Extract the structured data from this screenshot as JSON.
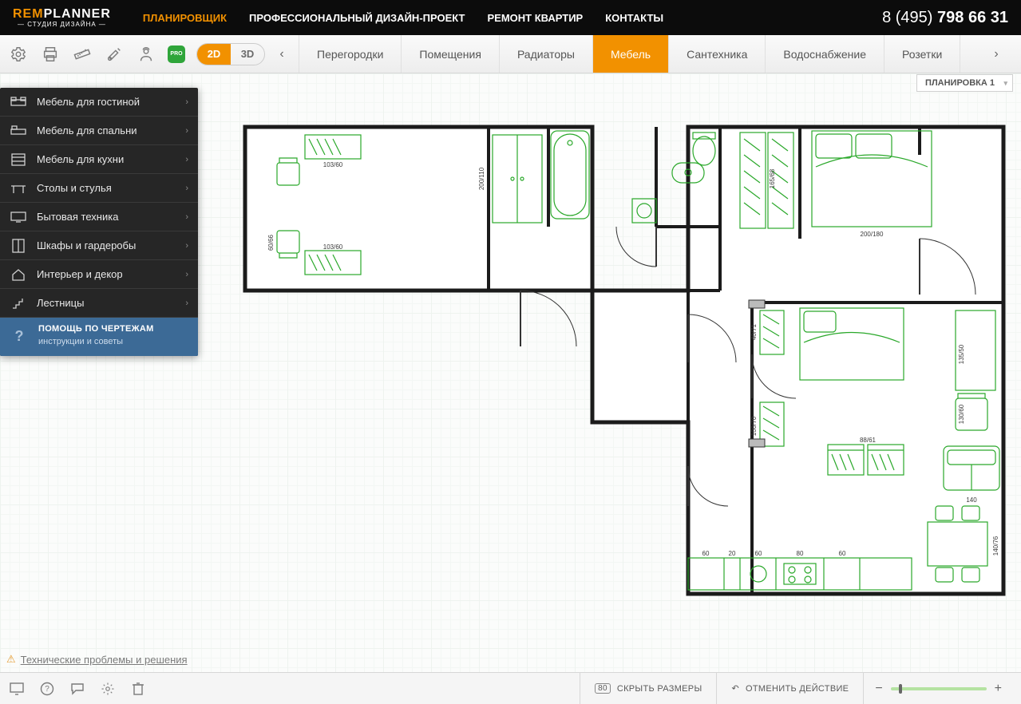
{
  "logo": {
    "brand_a": "REM",
    "brand_b": "PLANNER",
    "subtitle": "— СТУДИЯ ДИЗАЙНА —"
  },
  "nav": {
    "items": [
      "ПЛАНИРОВЩИК",
      "ПРОФЕССИОНАЛЬНЫЙ ДИЗАЙН-ПРОЕКТ",
      "РЕМОНТ КВАРТИР",
      "КОНТАКТЫ"
    ],
    "active_index": 0
  },
  "phone": {
    "prefix": "8 (495) ",
    "main": "798 66 31"
  },
  "toolbar": {
    "pro": "PRO",
    "view_2d": "2D",
    "view_3d": "3D",
    "tabs": [
      "Перегородки",
      "Помещения",
      "Радиаторы",
      "Мебель",
      "Сантехника",
      "Водоснабжение",
      "Розетки"
    ],
    "active_tab_index": 3
  },
  "plan_chip": "ПЛАНИРОВКА 1",
  "sidebar": {
    "items": [
      "Мебель для гостиной",
      "Мебель для спальни",
      "Мебель для кухни",
      "Столы и стулья",
      "Бытовая техника",
      "Шкафы и гардеробы",
      "Интерьер и декор",
      "Лестницы"
    ],
    "help_title": "ПОМОЩЬ ПО ЧЕРТЕЖАМ",
    "help_sub": "инструкции и советы"
  },
  "tech_link": "Технические проблемы и решения",
  "bottombar": {
    "hide_sizes": "СКРЫТЬ РАЗМЕРЫ",
    "undo": "ОТМЕНИТЬ ДЕЙСТВИЕ"
  },
  "dimensions": {
    "left_room_top": "103/60",
    "left_room_bottom": "103/60",
    "left_height": "200/110",
    "left_chair": "60/66",
    "bed1": "200/180",
    "wardrobe1": "165/68",
    "bed2_h": "135/50",
    "bed2_w": "130/60",
    "kitchen_top": "88/61",
    "sofa": "140",
    "counter_h": "140/76",
    "u1": "60",
    "u2": "20",
    "u3": "60",
    "u4": "80",
    "u5": "60",
    "doorpan": "100/70",
    "closet_small": "40/71"
  }
}
